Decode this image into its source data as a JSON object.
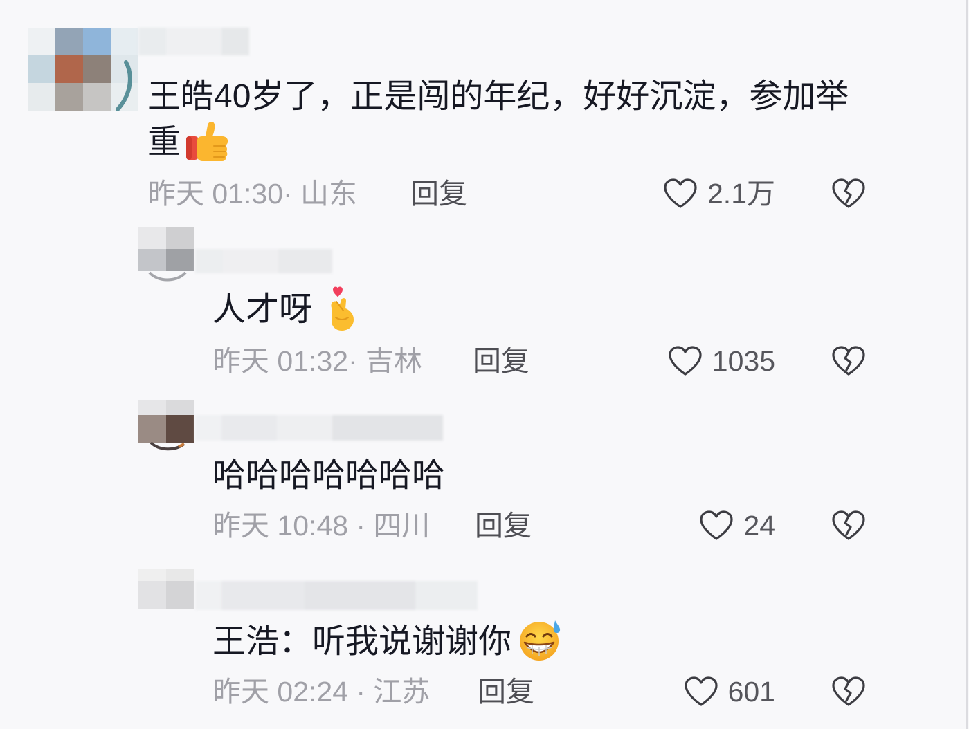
{
  "colors": {
    "background": "#f8f8fa",
    "text": "#161823",
    "meta": "#a0a0a7",
    "action": "#4e4e54",
    "count": "#56565c",
    "icon": "#3c3c42"
  },
  "icons": {
    "like": "heart-outline-icon",
    "dislike": "broken-heart-icon"
  },
  "comments": [
    {
      "text": "王皓40岁了，正是闯的年纪，好好沉淀，参加举重",
      "emoji": "thumbs-up",
      "meta": "昨天 01:30· 山东",
      "reply_label": "回复",
      "likes": "2.1万"
    },
    {
      "text": "人才呀",
      "emoji": "finger-heart",
      "meta": "昨天 01:32· 吉林",
      "reply_label": "回复",
      "likes": "1035"
    },
    {
      "text": "哈哈哈哈哈哈哈",
      "meta": "昨天 10:48 · 四川",
      "reply_label": "回复",
      "likes": "24"
    },
    {
      "text": "王浩：听我说谢谢你",
      "emoji": "grinning-face-with-sweat",
      "meta": "昨天 02:24 · 江苏",
      "reply_label": "回复",
      "likes": "601"
    }
  ]
}
